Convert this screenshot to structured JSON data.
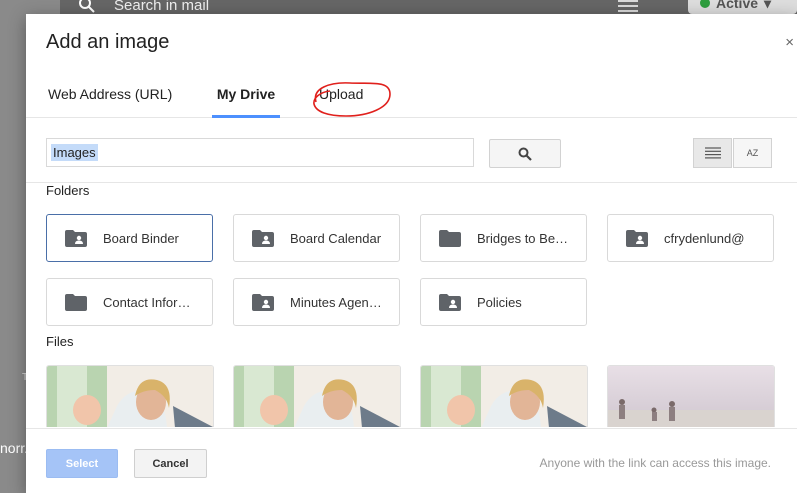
{
  "background": {
    "search_placeholder": "Search in mail",
    "status_label": "Active",
    "left_text": "norr.",
    "tick_text": "T"
  },
  "dialog": {
    "title": "Add an image",
    "close_glyph": "×",
    "tabs": [
      {
        "label": "Web Address (URL)",
        "active": false
      },
      {
        "label": "My Drive",
        "active": true
      },
      {
        "label": "Upload",
        "active": false
      }
    ],
    "search": {
      "value": "Images"
    },
    "sort_icon_text": "AZ",
    "folders_label": "Folders",
    "folders": [
      {
        "name": "Board Binder",
        "shared": true,
        "selected": true
      },
      {
        "name": "Board Calendar",
        "shared": true,
        "selected": false
      },
      {
        "name": "Bridges to Better",
        "shared": false,
        "selected": false
      },
      {
        "name": "cfrydenlund@",
        "shared": true,
        "selected": false
      },
      {
        "name": "Contact Information",
        "shared": false,
        "selected": false
      },
      {
        "name": "Minutes Agendas",
        "shared": true,
        "selected": false
      },
      {
        "name": "Policies",
        "shared": true,
        "selected": false
      }
    ],
    "files_label": "Files",
    "files": [
      {
        "kind": "photo-family"
      },
      {
        "kind": "photo-family"
      },
      {
        "kind": "photo-family"
      },
      {
        "kind": "photo-beach"
      }
    ],
    "footer": {
      "select_label": "Select",
      "cancel_label": "Cancel",
      "note": "Anyone with the link can access this image."
    }
  },
  "colors": {
    "accent": "#4d90fe",
    "select_disabled": "#a5c4f7",
    "annotation": "#e0201c"
  }
}
